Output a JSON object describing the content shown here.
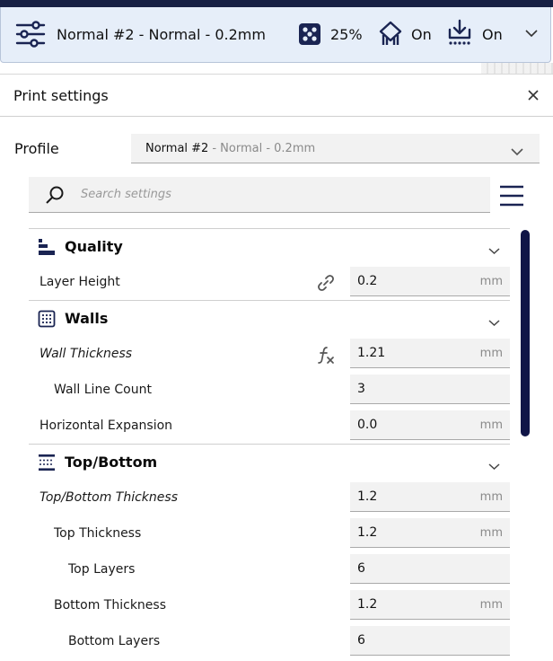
{
  "topbar": {
    "profile": "Normal #2 - Normal - 0.2mm",
    "infill": "25%",
    "support": "On",
    "adhesion": "On"
  },
  "panel": {
    "title": "Print settings",
    "profile_label": "Profile",
    "profile_main": "Normal #2",
    "profile_sub": "- Normal - 0.2mm",
    "search_placeholder": "Search settings"
  },
  "sections": {
    "quality": {
      "title": "Quality"
    },
    "walls": {
      "title": "Walls"
    },
    "topbottom": {
      "title": "Top/Bottom"
    }
  },
  "settings": {
    "layer_height": {
      "label": "Layer Height",
      "value": "0.2",
      "unit": "mm"
    },
    "wall_thickness": {
      "label": "Wall Thickness",
      "value": "1.21",
      "unit": "mm"
    },
    "wall_line_count": {
      "label": "Wall Line Count",
      "value": "3"
    },
    "horizontal_expansion": {
      "label": "Horizontal Expansion",
      "value": "0.0",
      "unit": "mm"
    },
    "topbottom_thickness": {
      "label": "Top/Bottom Thickness",
      "value": "1.2",
      "unit": "mm"
    },
    "top_thickness": {
      "label": "Top Thickness",
      "value": "1.2",
      "unit": "mm"
    },
    "top_layers": {
      "label": "Top Layers",
      "value": "6"
    },
    "bottom_thickness": {
      "label": "Bottom Thickness",
      "value": "1.2",
      "unit": "mm"
    },
    "bottom_layers": {
      "label": "Bottom Layers",
      "value": "6"
    }
  },
  "colors": {
    "accent_dark": "#101547",
    "topbar_bg": "#e6eef9",
    "field_bg": "#f2f2f2"
  },
  "icons": [
    "settings-sliders-icon",
    "infill-icon",
    "support-icon",
    "adhesion-icon",
    "chevron-down-icon",
    "close-icon",
    "search-icon",
    "hamburger-menu-icon",
    "quality-icon",
    "walls-icon",
    "topbottom-icon",
    "link-icon",
    "function-icon"
  ]
}
